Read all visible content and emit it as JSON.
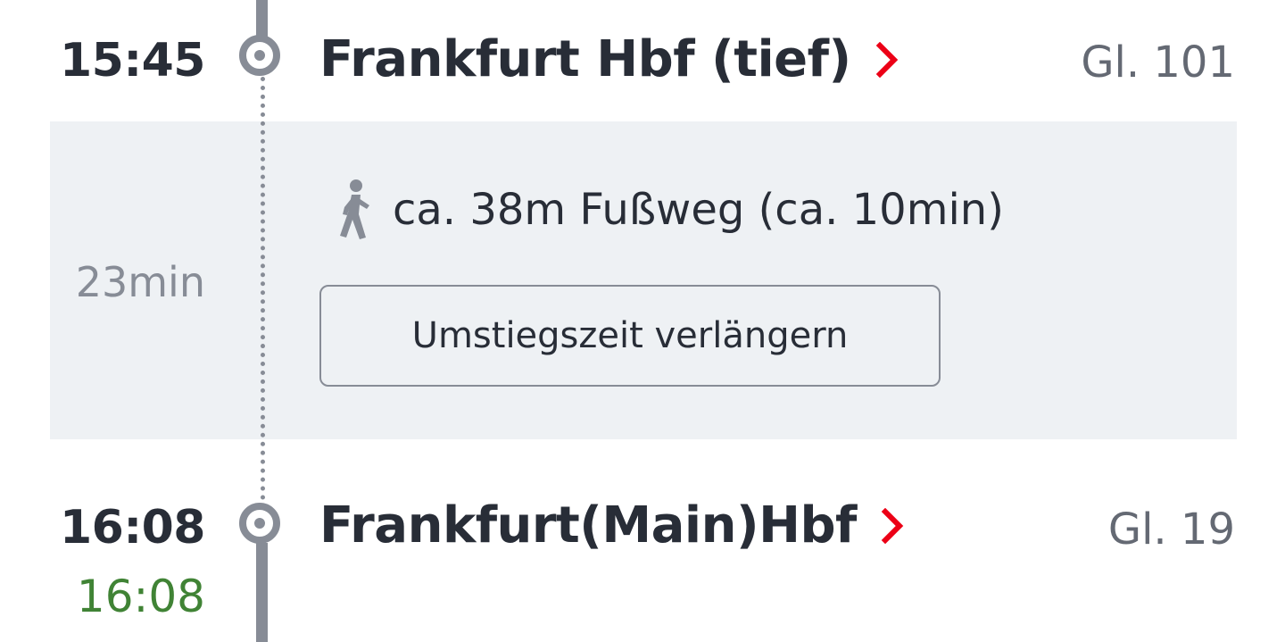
{
  "departure": {
    "time": "15:45",
    "station": "Frankfurt Hbf (tief)",
    "track": "Gl. 101"
  },
  "transfer": {
    "duration": "23min",
    "walk_text": "ca. 38m Fußweg (ca. 10min)",
    "extend_button_label": "Umstiegszeit verlängern"
  },
  "arrival": {
    "time": "16:08",
    "actual_time": "16:08",
    "station": "Frankfurt(Main)Hbf",
    "track": "Gl. 19"
  },
  "icons": {
    "chevron": "chevron-right-icon",
    "walk": "walking-person-icon"
  },
  "colors": {
    "accent": "#ec0016",
    "on_time": "#408335",
    "timeline": "#878c96",
    "panel_bg": "#eef1f4"
  }
}
